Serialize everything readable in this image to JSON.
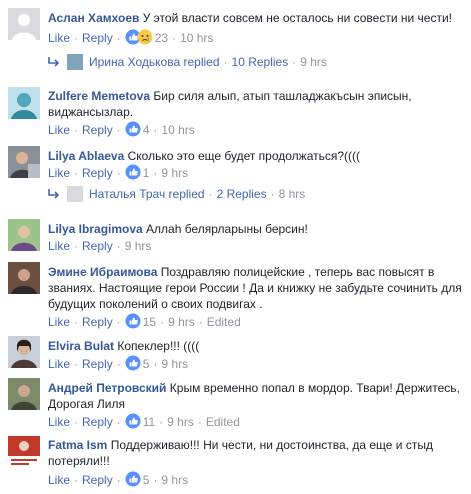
{
  "colors": {
    "link": "#4267b2",
    "author": "#365899",
    "muted": "#90949c",
    "like_blue": "#5890ff"
  },
  "labels": {
    "like": "Like",
    "reply": "Reply",
    "edited": "Edited",
    "dot": "·"
  },
  "comments": [
    {
      "author": "Аслан Хамхоев",
      "text": "У этой власти совсем не осталось ни совести ни чести!",
      "reactions": "like-sad",
      "count": "23",
      "time": "10 hrs",
      "edited": false,
      "avatar": "blank-avatar"
    },
    {
      "author": "Zulfere Memetova",
      "text": "Бир силя алып, атып ташладжакъсын эписын, виджансызлар.",
      "reactions": "like",
      "count": "4",
      "time": "10 hrs",
      "edited": false,
      "avatar": "photo-avatar"
    },
    {
      "author": "Lilya Ablaeva",
      "text": "Сколько это еще будет продолжаться?((((",
      "reactions": "like",
      "count": "1",
      "time": "9 hrs",
      "edited": false,
      "avatar": "photo-avatar"
    },
    {
      "author": "Lilya Ibragimova",
      "text": "Аллаh белярларыны берсин!",
      "reactions": "",
      "count": "",
      "time": "9 hrs",
      "edited": false,
      "avatar": "photo-avatar"
    },
    {
      "author": "Эмине Ибраимова",
      "text": "Поздравляю полицейские , теперь вас повысят в званиях. Настоящие герои России ! Да и книжку не забудьте сочинить для будущих поколений о своих подвигах .",
      "reactions": "like",
      "count": "15",
      "time": "9 hrs",
      "edited": true,
      "avatar": "photo-avatar"
    },
    {
      "author": "Elvira Bulat",
      "text": "Копеклер!!! ((((",
      "reactions": "like",
      "count": "5",
      "time": "9 hrs",
      "edited": false,
      "avatar": "photo-avatar"
    },
    {
      "author": "Андрей Петровский",
      "text": "Крым временно попал в мордор. Твари! Держитесь, Дорогая Лиля",
      "reactions": "like",
      "count": "11",
      "time": "9 hrs",
      "edited": true,
      "avatar": "photo-avatar"
    },
    {
      "author": "Fatma Ism",
      "text": "Поддерживаю!!! Ни чести, ни достоинства, да еще и стыд потеряли!!!",
      "reactions": "like",
      "count": "5",
      "time": "9 hrs",
      "edited": false,
      "avatar": "photo-avatar"
    }
  ],
  "reply_rows": [
    {
      "name": "Ирина Ходькова",
      "replied": "replied",
      "replies": "10 Replies",
      "time": "9 hrs"
    },
    {
      "name": "Наталья Трач",
      "replied": "replied",
      "replies": "2 Replies",
      "time": "8 hrs"
    }
  ]
}
